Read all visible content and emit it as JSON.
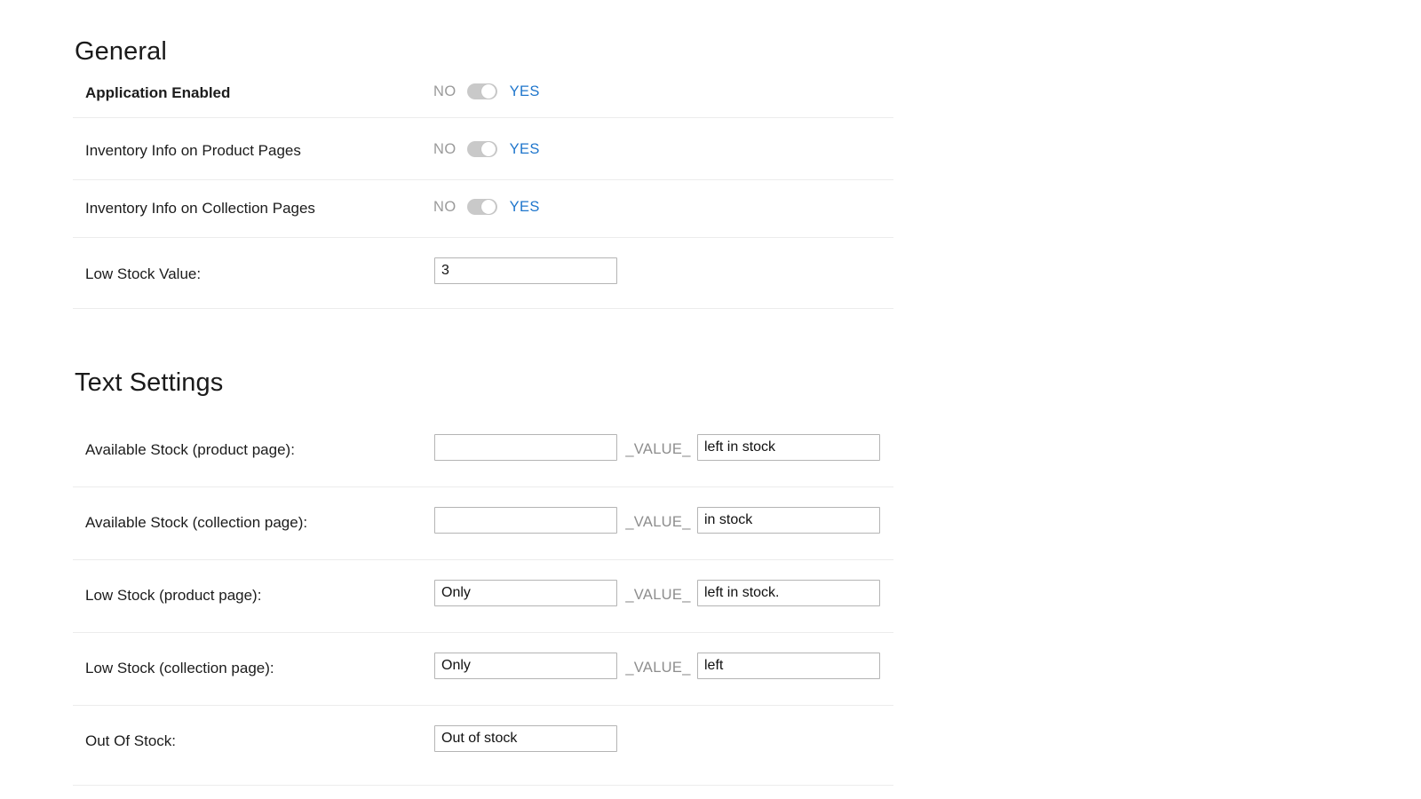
{
  "sections": {
    "general": {
      "title": "General",
      "rows": [
        {
          "label": "Application Enabled",
          "type": "toggle",
          "no_label": "NO",
          "yes_label": "YES",
          "state": "yes",
          "bold": true
        },
        {
          "label": "Inventory Info on Product Pages",
          "type": "toggle",
          "no_label": "NO",
          "yes_label": "YES",
          "state": "yes",
          "bold": false
        },
        {
          "label": "Inventory Info on Collection Pages",
          "type": "toggle",
          "no_label": "NO",
          "yes_label": "YES",
          "state": "yes",
          "bold": false
        },
        {
          "label": "Low Stock Value:",
          "type": "single_input",
          "value": "3",
          "placeholder": "",
          "bold": false
        }
      ]
    },
    "text_settings": {
      "title": "Text Settings",
      "separator_label": "_VALUE_",
      "rows": [
        {
          "label": "Available Stock (product page):",
          "type": "dual_input",
          "prefix_value": "",
          "prefix_placeholder": "",
          "suffix_value": "left in stock",
          "suffix_placeholder": ""
        },
        {
          "label": "Available Stock (collection page):",
          "type": "dual_input",
          "prefix_value": "",
          "prefix_placeholder": "",
          "suffix_value": "in stock",
          "suffix_placeholder": ""
        },
        {
          "label": "Low Stock (product page):",
          "type": "dual_input",
          "prefix_value": "Only",
          "prefix_placeholder": "",
          "suffix_value": "left in stock.",
          "suffix_placeholder": ""
        },
        {
          "label": "Low Stock (collection page):",
          "type": "dual_input",
          "prefix_value": "Only",
          "prefix_placeholder": "",
          "suffix_value": "left",
          "suffix_placeholder": ""
        },
        {
          "label": "Out Of Stock:",
          "type": "single_input",
          "value": "Out of stock",
          "placeholder": ""
        }
      ]
    }
  },
  "colors": {
    "accent_blue": "#1f76cc",
    "muted_grey": "#9a9a9a",
    "divider": "#ececec",
    "input_border": "#b4b4b4",
    "toggle_track": "#c9c9c9"
  }
}
